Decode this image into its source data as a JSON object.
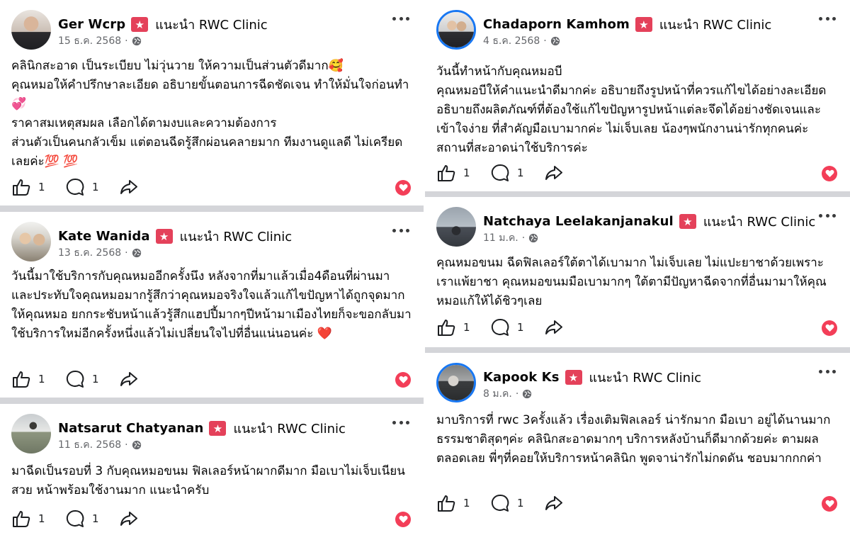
{
  "recommend_label": "แนะนำ RWC Clinic",
  "left_reviews": [
    {
      "name": "Ger Wcrp",
      "date": "15 ธ.ค. 2568",
      "body": "คลินิกสะอาด เป็นระเบียบ ไม่วุ่นวาย ให้ความเป็นส่วนตัวดีมาก🥰\nคุณหมอให้คำปรึกษาละเอียด อธิบายขั้นตอนการฉีดชัดเจน ทำให้มั่นใจก่อนทำ💞\nราคาสมเหตุสมผล เลือกได้ตามงบและความต้องการ\nส่วนตัวเป็นคนกลัวเข็ม แต่ตอนฉีดรู้สึกผ่อนคลายมาก ทีมงานดูแลดี ไม่เครียดเลยค่ะ💯 💯",
      "likes": "1",
      "comments": "1"
    },
    {
      "name": "Kate Wanida",
      "date": "13 ธ.ค. 2568",
      "body": "วันนี้มาใช้บริการกับคุณหมออีกครั้งนึง หลังจากที่มาแล้วเมื่อ4ดือนที่ผ่านมา และประทับใจคุณหมอมากรู้สึกว่าคุณหมอจริงใจแล้วแก้ไขปัญหาได้ถูกจุดมากให้คุณหมอ ยกกระชับหน้าแล้วรู้สึกแฮปปี้มากๆปีหน้ามาเมืองไทยก็จะขอกลับมาใช้บริการใหม่อีกครั้งหนึ่งแล้วไม่เปลี่ยนใจไปที่อื่นแน่นอนค่ะ ❤️",
      "likes": "1",
      "comments": "1"
    },
    {
      "name": "Natsarut Chatyanan",
      "date": "11 ธ.ค. 2568",
      "body": "มาฉีดเป็นรอบที่ 3 กับคุณหมอขนม ฟิลเลอร์หน้าผากดีมาก มือเบาไม่เจ็บเนียน สวย หน้าพร้อมใช้งานมาก แนะนำครับ",
      "likes": "1",
      "comments": "1"
    }
  ],
  "right_reviews": [
    {
      "name": "Chadaporn Kamhom",
      "date": "4 ธ.ค. 2568",
      "body": "วันนี้ทำหน้ากับคุณหมอบี\nคุณหมอบีให้คำแนะนำดีมากค่ะ อธิบายถึงรูปหน้าที่ควรแก้ไขได้อย่างละเอียด อธิบายถึงผลิตภัณฑ์ที่ต้องใช้แก้ไขปัญหารูปหน้าแต่ละจึดได้อย่างชัดเจนและเข้าใจง่าย ที่สำคัญมือเบามากค่ะ ไม่เจ็บเลย น้องๆพนักงานน่ารักทุกคนค่ะ สถานที่สะอาดน่าใช้บริการค่ะ",
      "likes": "1",
      "comments": "1"
    },
    {
      "name": "Natchaya Leelakanjanakul",
      "date": "11 ม.ค.",
      "body": "คุณหมอขนม ฉีดฟิลเลอร์ใต้ตาได้เบามาก ไม่เจ็บเลย ไม่แปะยาชาด้วยเพราะเราแพ้ยาชา คุณหมอขนมมือเบามากๆ ใต้ตามีปัญหาฉีดจากที่อื่นมามาให้คุณหมอแก้ให้ได้ชิวๆเลย",
      "likes": "1",
      "comments": "1"
    },
    {
      "name": "Kapook Ks",
      "date": "8 ม.ค.",
      "body": "มาบริการที่ rwc 3ครั้งแล้ว เรื่องเติมฟิลเลอร์ น่ารักมาก มือเบา อยู่ได้นานมาก ธรรมชาติสุดๆค่ะ คลินิกสะอาดมากๆ บริการหลังบ้านก็ดีมากด้วยค่ะ ตามผลตลอดเลย พี่ๆที่คอยให้บริการหน้าคลินิก พูดจาน่ารักไม่กดดัน ชอบมากกกค่า",
      "likes": "1",
      "comments": "1"
    }
  ],
  "colors": {
    "recommend_badge": "#e4415a",
    "love_reaction": "#f33e58",
    "divider": "#d4d5d9",
    "meta_text": "#65676b",
    "avatar_ring": "#1877f2"
  },
  "icons": [
    "star-badge-icon",
    "globe-icon",
    "more-options-icon",
    "like-icon",
    "comment-icon",
    "share-icon",
    "love-reaction-icon"
  ]
}
